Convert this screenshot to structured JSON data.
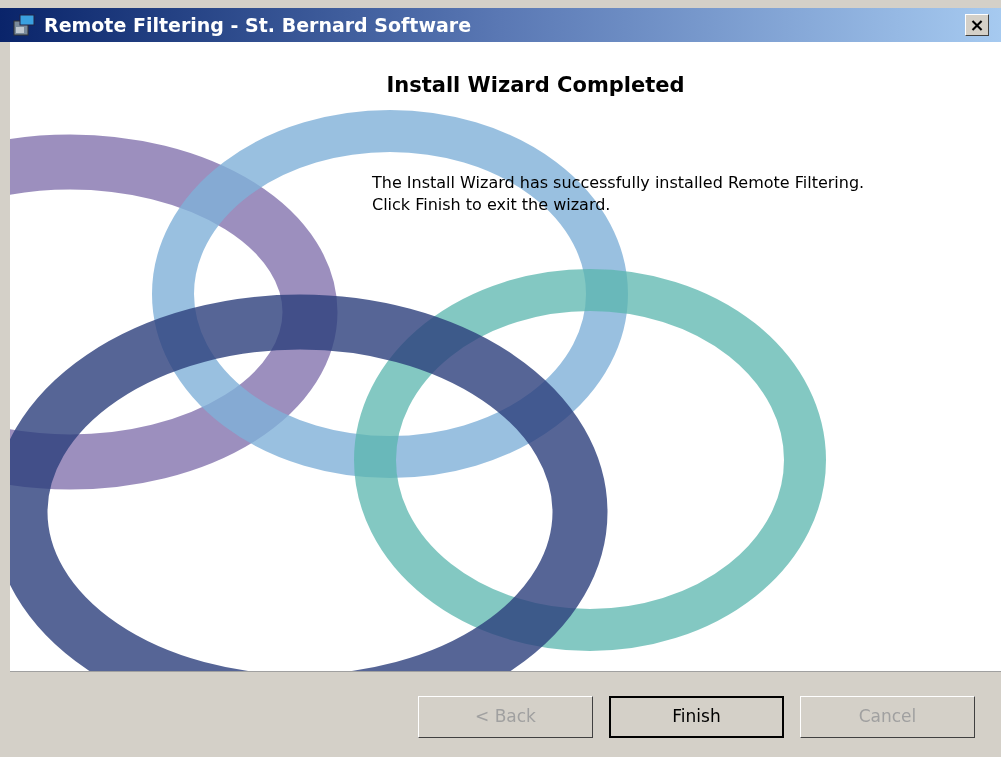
{
  "window": {
    "title": "Remote Filtering - St. Bernard Software",
    "close": "×"
  },
  "heading": "Install Wizard Completed",
  "message": [
    "The Install Wizard has successfully installed Remote Filtering.",
    "Click Finish to exit the wizard."
  ],
  "buttons": [
    {
      "label": "< Back",
      "disabled": true,
      "default": false
    },
    {
      "label": "Finish",
      "disabled": false,
      "default": true
    },
    {
      "label": "Cancel",
      "disabled": true,
      "default": false
    }
  ]
}
